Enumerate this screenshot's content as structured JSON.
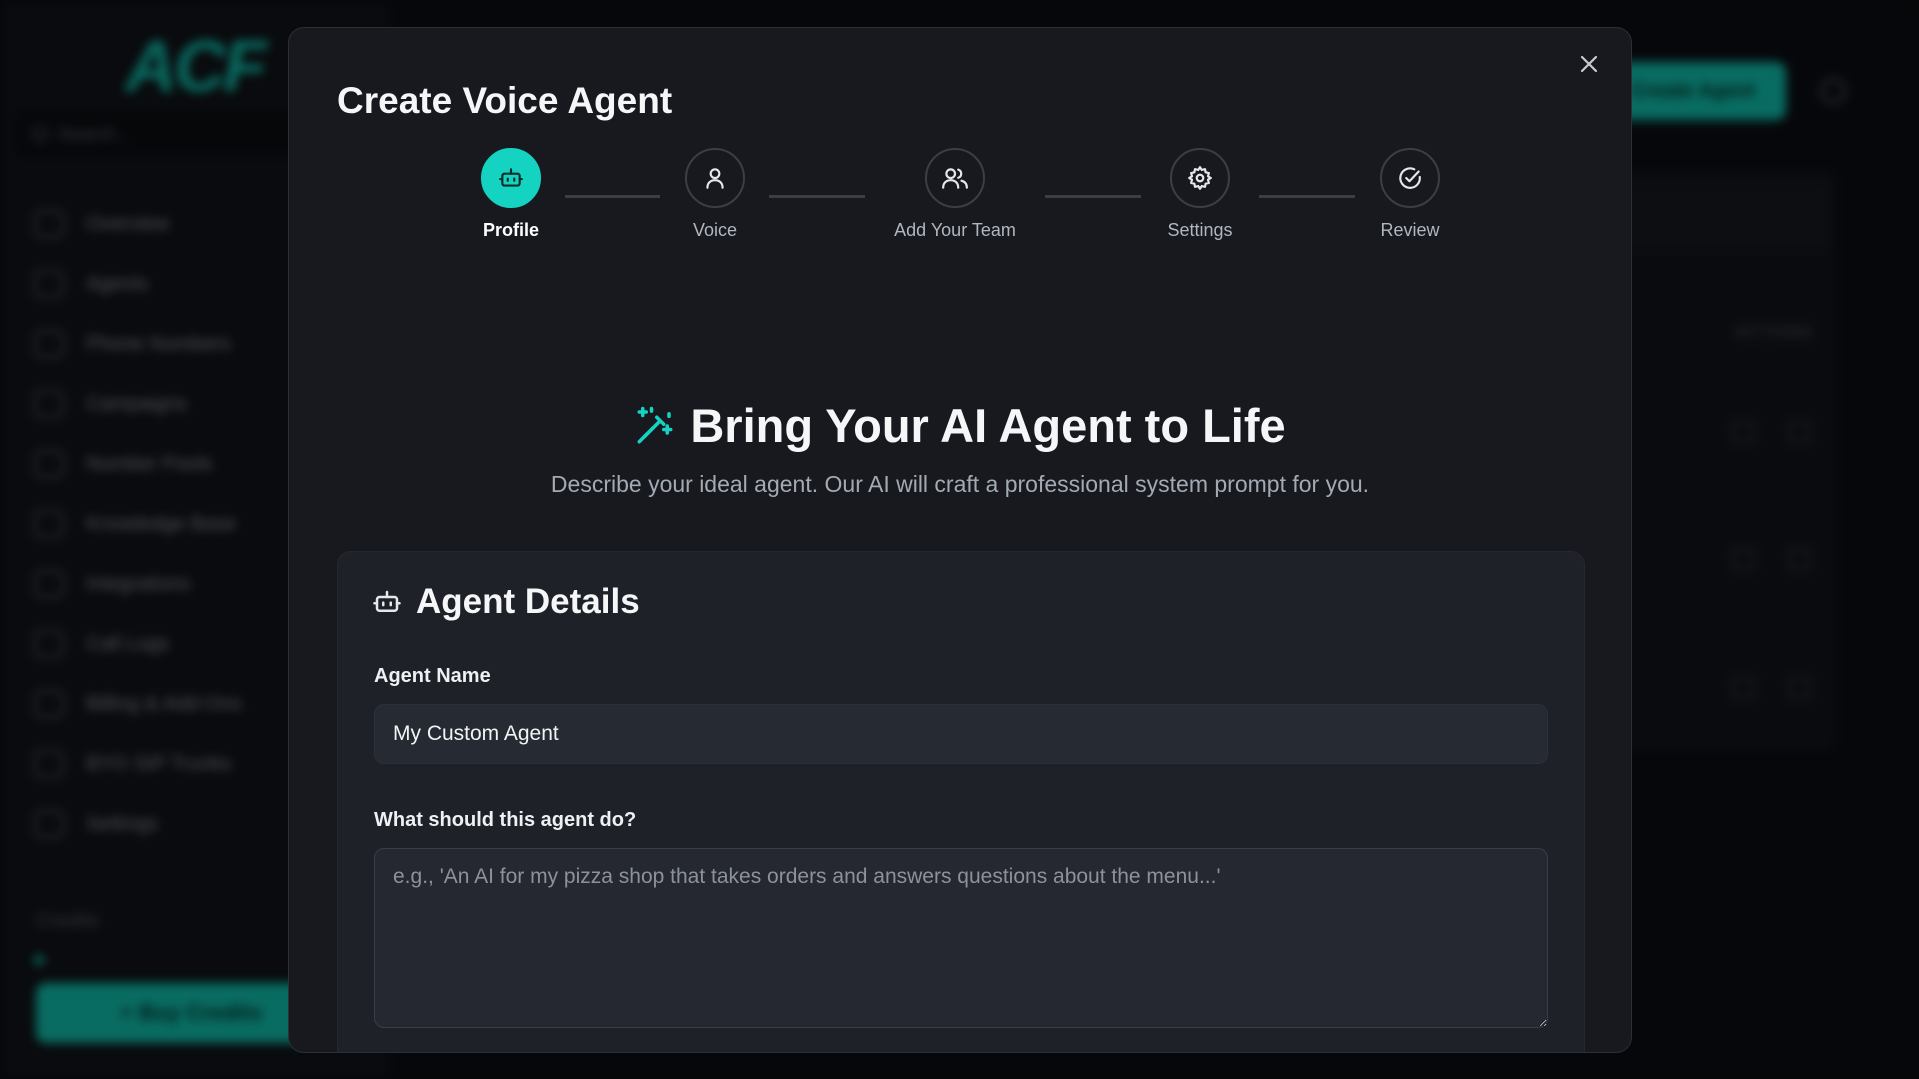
{
  "background_app": {
    "logo": "ACF",
    "search_placeholder": "Search...",
    "nav_items": [
      "Overview",
      "Agents",
      "Phone Numbers",
      "Campaigns",
      "Number Pools",
      "Knowledge Base",
      "Integrations",
      "Call Logs",
      "Billing & Add-Ons",
      "BYO SIP Trunks",
      "Settings"
    ],
    "credits_label": "Credits",
    "buy_credits_label": "+ Buy Credits",
    "create_agent_label": "Create Agent",
    "actions_header": "ACTIONS"
  },
  "modal": {
    "title": "Create Voice Agent",
    "close_label": "×",
    "steps": [
      {
        "label": "Profile",
        "icon": "bot-icon",
        "active": true
      },
      {
        "label": "Voice",
        "icon": "user-icon",
        "active": false
      },
      {
        "label": "Add Your Team",
        "icon": "users-icon",
        "active": false
      },
      {
        "label": "Settings",
        "icon": "gear-icon",
        "active": false
      },
      {
        "label": "Review",
        "icon": "check-circle-icon",
        "active": false
      }
    ],
    "hero": {
      "title": "Bring Your AI Agent to Life",
      "subtitle": "Describe your ideal agent. Our AI will craft a professional system prompt for you.",
      "icon": "magic-wand-icon"
    },
    "card": {
      "title": "Agent Details",
      "icon": "bot-icon",
      "agent_name_label": "Agent Name",
      "agent_name_value": "My Custom Agent",
      "description_label": "What should this agent do?",
      "description_placeholder": "e.g., 'An AI for my pizza shop that takes orders and answers questions about the menu...'"
    }
  },
  "colors": {
    "accent": "#14d3c0",
    "modal_bg": "#17191f",
    "card_bg": "#1e2128",
    "input_bg": "#262a32"
  }
}
